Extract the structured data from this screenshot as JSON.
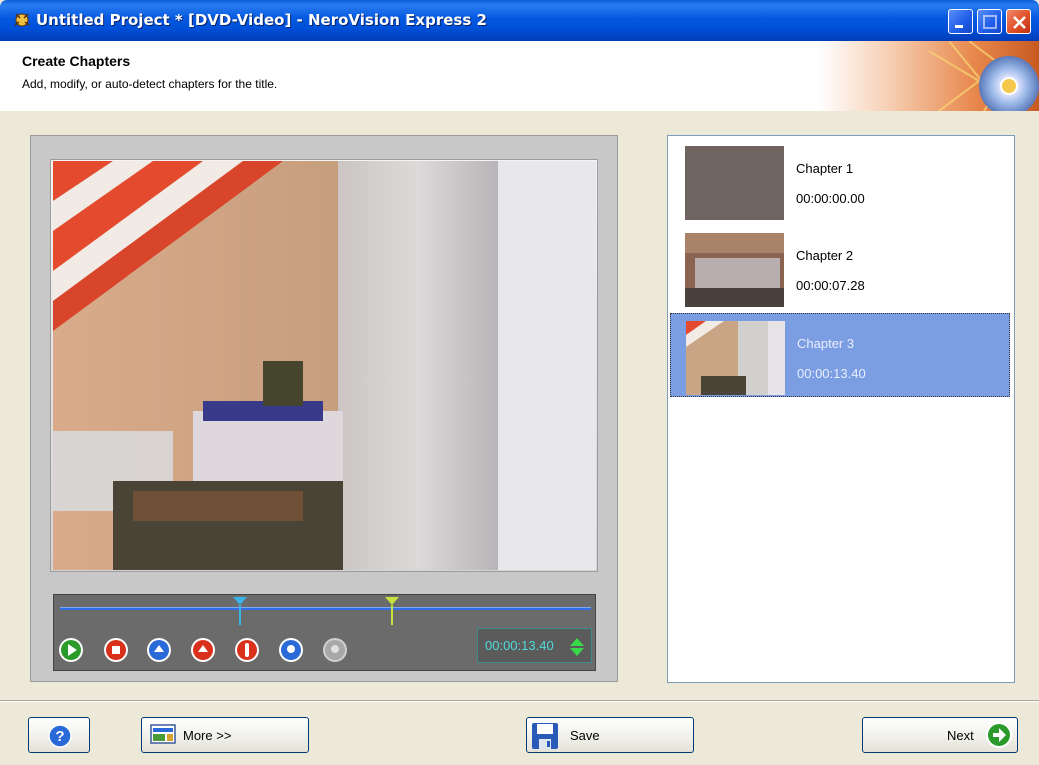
{
  "window": {
    "title": "Untitled Project * [DVD-Video] - NeroVision Express 2"
  },
  "header": {
    "title": "Create Chapters",
    "subtitle": "Add, modify, or auto-detect chapters for the title."
  },
  "player": {
    "timecode": "00:00:13.40",
    "controls": [
      "play-icon",
      "stop-icon",
      "set-chapter-icon",
      "remove-chapter-icon",
      "auto-detect-icon",
      "chapter-options-icon",
      "disabled-action-icon"
    ]
  },
  "chapters": [
    {
      "name": "Chapter 1",
      "time": "00:00:00.00"
    },
    {
      "name": "Chapter 2",
      "time": "00:00:07.28"
    },
    {
      "name": "Chapter 3",
      "time": "00:00:13.40"
    }
  ],
  "selected_chapter": 3,
  "buttons": {
    "more": "More >>",
    "save": "Save",
    "next": "Next"
  },
  "colors": {
    "titlebar": "#0054e3",
    "selection": "#7b9ee2",
    "timecode": "#4fd9d9"
  }
}
